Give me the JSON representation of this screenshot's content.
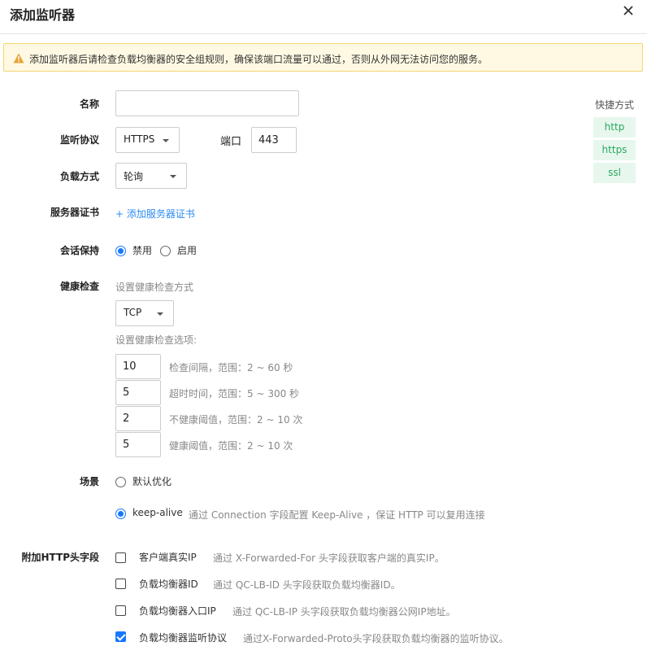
{
  "dialog": {
    "title": "添加监听器",
    "warning": "添加监听器后请检查负载均衡器的安全组规则，确保该端口流量可以通过，否则从外网无法访问您的服务。"
  },
  "form": {
    "name_label": "名称",
    "name_value": "",
    "protocol_label": "监听协议",
    "protocol_value": "HTTPS",
    "port_label": "端口",
    "port_value": "443",
    "lb_method_label": "负载方式",
    "lb_method_value": "轮询",
    "cert_label": "服务器证书",
    "cert_link": "+ 添加服务器证书",
    "session_label": "会话保持",
    "session_options": [
      "禁用",
      "启用"
    ],
    "session_selected": "禁用",
    "health_label": "健康检查",
    "health_method_hint": "设置健康检查方式",
    "health_method_value": "TCP",
    "health_options_hint": "设置健康检查选项:",
    "health_fields": [
      {
        "value": "10",
        "desc": "检查间隔，范围：2 ~ 60 秒"
      },
      {
        "value": "5",
        "desc": "超时时间，范围：5 ~ 300 秒"
      },
      {
        "value": "2",
        "desc": "不健康阈值，范围：2 ~ 10 次"
      },
      {
        "value": "5",
        "desc": "健康阈值，范围：2 ~ 10 次"
      }
    ],
    "scene_label": "场景",
    "scene_options": [
      {
        "label": "默认优化",
        "desc": ""
      },
      {
        "label": "keep-alive",
        "desc": "通过 Connection 字段配置 Keep-Alive ，保证 HTTP 可以复用连接"
      }
    ],
    "scene_selected": "keep-alive",
    "headers_label": "附加HTTP头字段",
    "headers": [
      {
        "label": "客户端真实IP",
        "desc": "通过 X-Forwarded-For 头字段获取客户端的真实IP。",
        "checked": false
      },
      {
        "label": "负载均衡器ID",
        "desc": "通过 QC-LB-ID 头字段获取负载均衡器ID。",
        "checked": false
      },
      {
        "label": "负载均衡器入口IP",
        "desc": "通过 QC-LB-IP 头字段获取负载均衡器公网IP地址。",
        "checked": false
      },
      {
        "label": "负载均衡器监听协议",
        "desc": "通过X-Forwarded-Proto头字段获取负载均衡器的监听协议。",
        "checked": true
      }
    ]
  },
  "shortcuts": {
    "title": "快捷方式",
    "items": [
      "http",
      "https",
      "ssl"
    ]
  },
  "colors": {
    "accent": "#1677ff",
    "link": "#2d8cf0",
    "warning_bg": "#fff9e3",
    "warning_border": "#f5d66f",
    "shortcut_bg": "#e8f7ee",
    "shortcut_text": "#28a960"
  }
}
